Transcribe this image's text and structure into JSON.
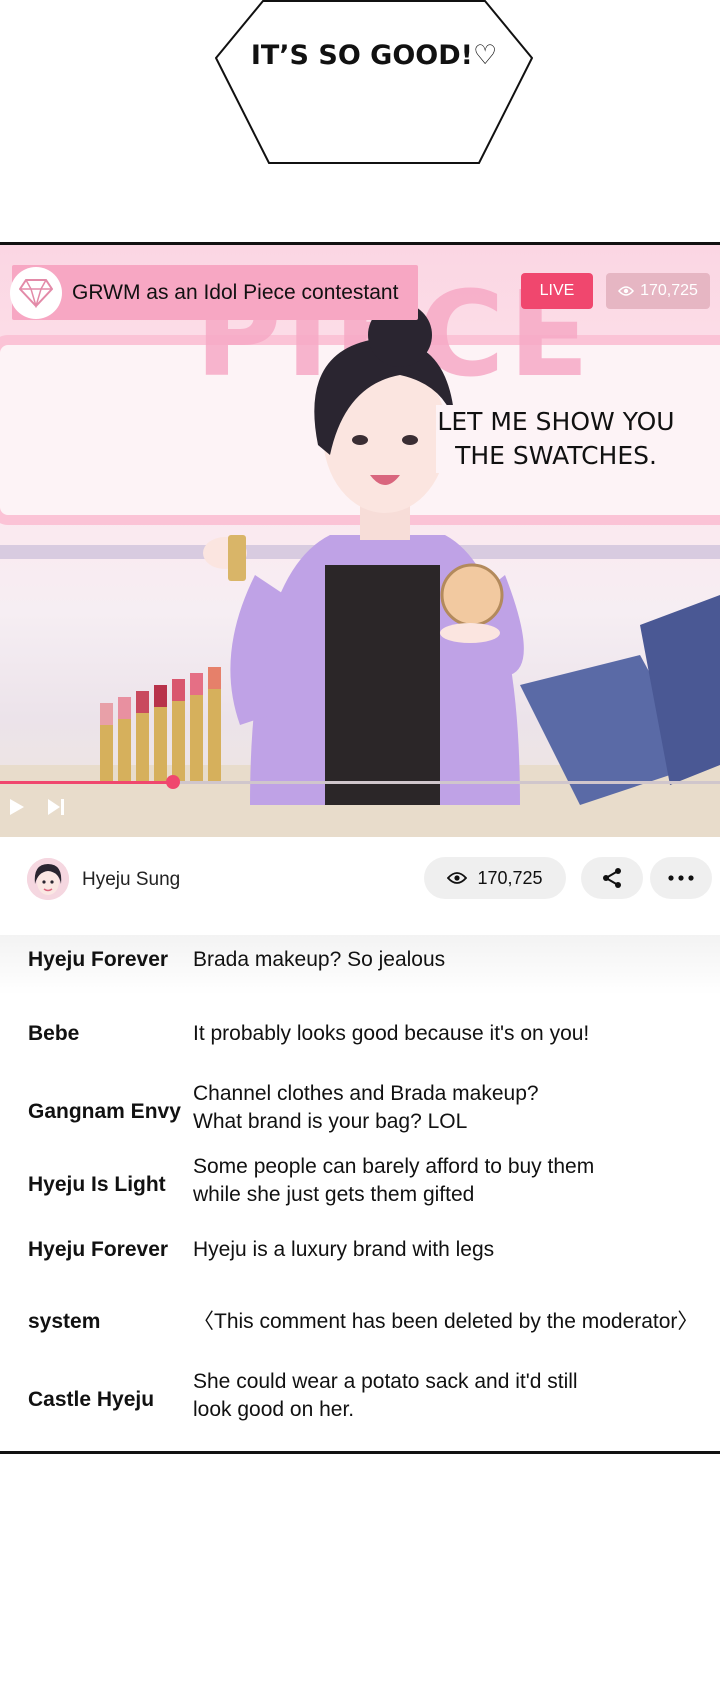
{
  "caption": {
    "text": "IT’S SO GOOD!♡"
  },
  "stream": {
    "title": "GRWM as an Idol Piece contestant",
    "live_label": "LIVE",
    "viewer_count": "170,725",
    "background_word": "PIECE",
    "speech_bubble": [
      "LET ME SHOW YOU",
      "THE SWATCHES."
    ],
    "playback_progress": 0.24,
    "colors": {
      "live": "#f0476e",
      "title_chip": "#f7a7c3",
      "view_chip": "#e6b6c3"
    }
  },
  "streamer": {
    "name": "Hyeju Sung",
    "views": "170,725"
  },
  "icons": {
    "logo": "diamond-logo-icon",
    "views": "eye-icon",
    "share": "share-icon",
    "more": "more-dots-icon",
    "play": "play-icon",
    "next": "skip-next-icon"
  },
  "comments": [
    {
      "user": "Hyeju Forever",
      "text": [
        "Brada makeup? So jealous"
      ]
    },
    {
      "user": "Bebe",
      "text": [
        "It probably looks good because it's on you!"
      ]
    },
    {
      "user": "Gangnam Envy",
      "text": [
        "Channel clothes and Brada makeup?",
        "What brand is your bag? LOL"
      ]
    },
    {
      "user": "Hyeju Is Light",
      "text": [
        "Some people can barely afford to buy them",
        "while she just gets them gifted"
      ]
    },
    {
      "user": "Hyeju Forever",
      "text": [
        "Hyeju is a luxury brand with legs"
      ]
    },
    {
      "user": "system",
      "text": [
        "〈This comment has been deleted by the moderator〉"
      ]
    },
    {
      "user": "Castle Hyeju",
      "text": [
        "She could wear a potato sack and it'd still",
        "look good on her."
      ]
    }
  ]
}
